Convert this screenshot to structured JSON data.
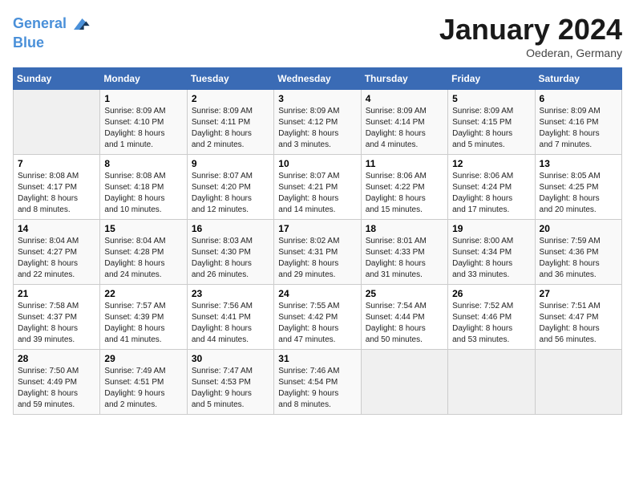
{
  "header": {
    "logo_line1": "General",
    "logo_line2": "Blue",
    "month_title": "January 2024",
    "location": "Oederan, Germany"
  },
  "days_of_week": [
    "Sunday",
    "Monday",
    "Tuesday",
    "Wednesday",
    "Thursday",
    "Friday",
    "Saturday"
  ],
  "weeks": [
    [
      {
        "day": "",
        "info": ""
      },
      {
        "day": "1",
        "info": "Sunrise: 8:09 AM\nSunset: 4:10 PM\nDaylight: 8 hours\nand 1 minute."
      },
      {
        "day": "2",
        "info": "Sunrise: 8:09 AM\nSunset: 4:11 PM\nDaylight: 8 hours\nand 2 minutes."
      },
      {
        "day": "3",
        "info": "Sunrise: 8:09 AM\nSunset: 4:12 PM\nDaylight: 8 hours\nand 3 minutes."
      },
      {
        "day": "4",
        "info": "Sunrise: 8:09 AM\nSunset: 4:14 PM\nDaylight: 8 hours\nand 4 minutes."
      },
      {
        "day": "5",
        "info": "Sunrise: 8:09 AM\nSunset: 4:15 PM\nDaylight: 8 hours\nand 5 minutes."
      },
      {
        "day": "6",
        "info": "Sunrise: 8:09 AM\nSunset: 4:16 PM\nDaylight: 8 hours\nand 7 minutes."
      }
    ],
    [
      {
        "day": "7",
        "info": "Sunrise: 8:08 AM\nSunset: 4:17 PM\nDaylight: 8 hours\nand 8 minutes."
      },
      {
        "day": "8",
        "info": "Sunrise: 8:08 AM\nSunset: 4:18 PM\nDaylight: 8 hours\nand 10 minutes."
      },
      {
        "day": "9",
        "info": "Sunrise: 8:07 AM\nSunset: 4:20 PM\nDaylight: 8 hours\nand 12 minutes."
      },
      {
        "day": "10",
        "info": "Sunrise: 8:07 AM\nSunset: 4:21 PM\nDaylight: 8 hours\nand 14 minutes."
      },
      {
        "day": "11",
        "info": "Sunrise: 8:06 AM\nSunset: 4:22 PM\nDaylight: 8 hours\nand 15 minutes."
      },
      {
        "day": "12",
        "info": "Sunrise: 8:06 AM\nSunset: 4:24 PM\nDaylight: 8 hours\nand 17 minutes."
      },
      {
        "day": "13",
        "info": "Sunrise: 8:05 AM\nSunset: 4:25 PM\nDaylight: 8 hours\nand 20 minutes."
      }
    ],
    [
      {
        "day": "14",
        "info": "Sunrise: 8:04 AM\nSunset: 4:27 PM\nDaylight: 8 hours\nand 22 minutes."
      },
      {
        "day": "15",
        "info": "Sunrise: 8:04 AM\nSunset: 4:28 PM\nDaylight: 8 hours\nand 24 minutes."
      },
      {
        "day": "16",
        "info": "Sunrise: 8:03 AM\nSunset: 4:30 PM\nDaylight: 8 hours\nand 26 minutes."
      },
      {
        "day": "17",
        "info": "Sunrise: 8:02 AM\nSunset: 4:31 PM\nDaylight: 8 hours\nand 29 minutes."
      },
      {
        "day": "18",
        "info": "Sunrise: 8:01 AM\nSunset: 4:33 PM\nDaylight: 8 hours\nand 31 minutes."
      },
      {
        "day": "19",
        "info": "Sunrise: 8:00 AM\nSunset: 4:34 PM\nDaylight: 8 hours\nand 33 minutes."
      },
      {
        "day": "20",
        "info": "Sunrise: 7:59 AM\nSunset: 4:36 PM\nDaylight: 8 hours\nand 36 minutes."
      }
    ],
    [
      {
        "day": "21",
        "info": "Sunrise: 7:58 AM\nSunset: 4:37 PM\nDaylight: 8 hours\nand 39 minutes."
      },
      {
        "day": "22",
        "info": "Sunrise: 7:57 AM\nSunset: 4:39 PM\nDaylight: 8 hours\nand 41 minutes."
      },
      {
        "day": "23",
        "info": "Sunrise: 7:56 AM\nSunset: 4:41 PM\nDaylight: 8 hours\nand 44 minutes."
      },
      {
        "day": "24",
        "info": "Sunrise: 7:55 AM\nSunset: 4:42 PM\nDaylight: 8 hours\nand 47 minutes."
      },
      {
        "day": "25",
        "info": "Sunrise: 7:54 AM\nSunset: 4:44 PM\nDaylight: 8 hours\nand 50 minutes."
      },
      {
        "day": "26",
        "info": "Sunrise: 7:52 AM\nSunset: 4:46 PM\nDaylight: 8 hours\nand 53 minutes."
      },
      {
        "day": "27",
        "info": "Sunrise: 7:51 AM\nSunset: 4:47 PM\nDaylight: 8 hours\nand 56 minutes."
      }
    ],
    [
      {
        "day": "28",
        "info": "Sunrise: 7:50 AM\nSunset: 4:49 PM\nDaylight: 8 hours\nand 59 minutes."
      },
      {
        "day": "29",
        "info": "Sunrise: 7:49 AM\nSunset: 4:51 PM\nDaylight: 9 hours\nand 2 minutes."
      },
      {
        "day": "30",
        "info": "Sunrise: 7:47 AM\nSunset: 4:53 PM\nDaylight: 9 hours\nand 5 minutes."
      },
      {
        "day": "31",
        "info": "Sunrise: 7:46 AM\nSunset: 4:54 PM\nDaylight: 9 hours\nand 8 minutes."
      },
      {
        "day": "",
        "info": ""
      },
      {
        "day": "",
        "info": ""
      },
      {
        "day": "",
        "info": ""
      }
    ]
  ]
}
